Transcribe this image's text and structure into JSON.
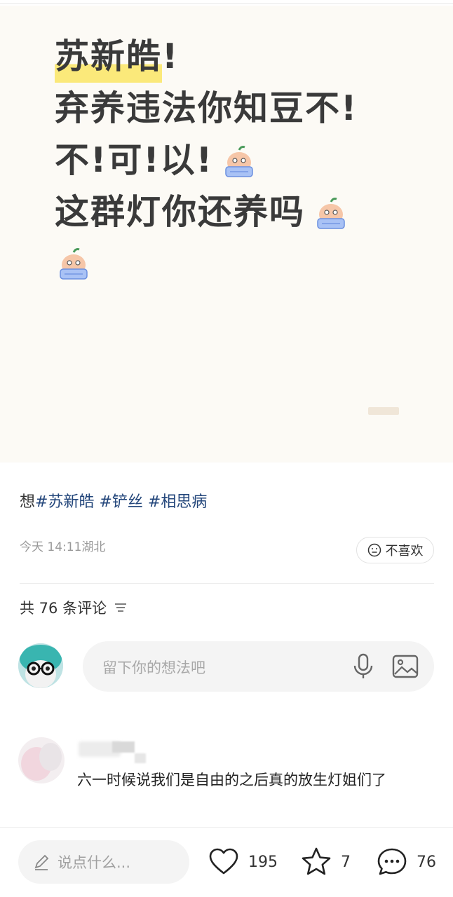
{
  "post": {
    "line1_highlight": "苏新皓",
    "line1_rest": "!",
    "line2": "弃养违法你知豆不!",
    "line3": "不!可!以!",
    "line4": "这群灯你还养吗",
    "emoji_name": "crying-face-emoji"
  },
  "tags": {
    "prefix": "想",
    "items": [
      "#苏新皓",
      "#铲丝",
      "#相思病"
    ]
  },
  "meta": {
    "time_location": "今天 14:11湖北",
    "dislike_label": "不喜欢"
  },
  "comments": {
    "count_label": "共 76 条评论",
    "input_placeholder": "留下你的想法吧",
    "first_comment_text": "六一时候说我们是自由的之后真的放生灯姐们了"
  },
  "bottom_bar": {
    "say_placeholder": "说点什么...",
    "like_count": "195",
    "favorite_count": "7",
    "comment_count": "76"
  },
  "colors": {
    "highlight": "#fbe97a",
    "tag_link": "#22457a",
    "image_bg": "#fcfaf5"
  }
}
